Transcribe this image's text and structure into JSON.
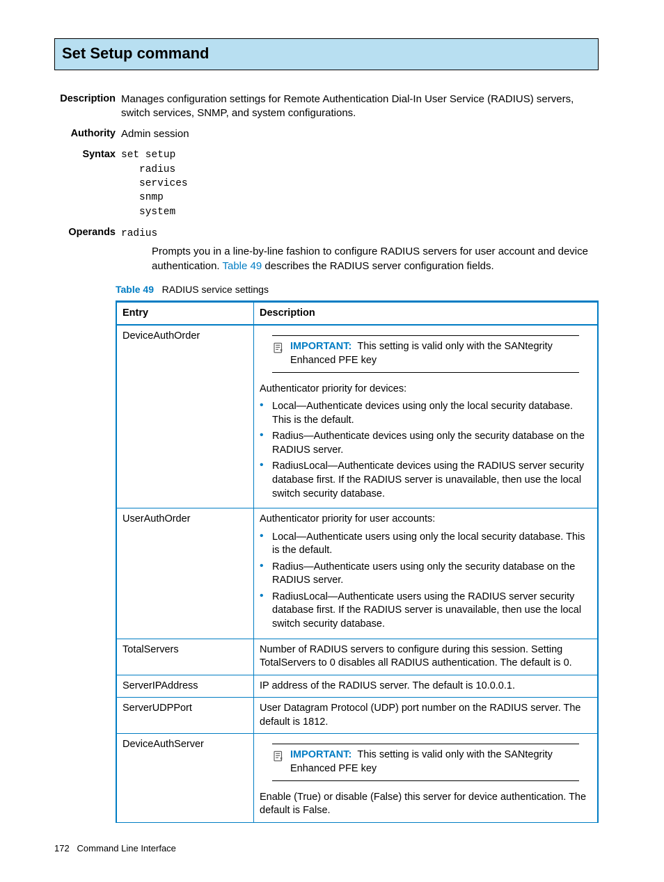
{
  "heading": "Set Setup command",
  "sections": {
    "description_label": "Description",
    "description_text": "Manages configuration settings for Remote Authentication Dial-In User Service (RADIUS) servers, switch services, SNMP, and system configurations.",
    "authority_label": "Authority",
    "authority_text": "Admin session",
    "syntax_label": "Syntax",
    "syntax_main": "set setup",
    "syntax_subs": [
      "radius",
      "services",
      "snmp",
      "system"
    ],
    "operands_label": "Operands",
    "operand_term": "radius",
    "operand_desc_1": "Prompts you in a line-by-line fashion to configure RADIUS servers for user account and device authentication. ",
    "operand_link": "Table 49",
    "operand_desc_2": " describes the RADIUS server configuration fields."
  },
  "table_caption_number": "Table 49",
  "table_caption_text": "RADIUS service settings",
  "table_headers": {
    "entry": "Entry",
    "description": "Description"
  },
  "important_label": "IMPORTANT:",
  "important_text": "This setting is valid only with the SANtegrity Enhanced PFE key",
  "rows": {
    "r1": {
      "entry": "DeviceAuthOrder",
      "para": "Authenticator priority for devices:",
      "b1": "Local—Authenticate devices using only the local security database. This is the default.",
      "b2": "Radius—Authenticate devices using only the security database on the RADIUS server.",
      "b3": "RadiusLocal—Authenticate devices using the RADIUS server security database first. If the RADIUS server is unavailable, then use the local switch security database."
    },
    "r2": {
      "entry": "UserAuthOrder",
      "para": "Authenticator priority for user accounts:",
      "b1": "Local—Authenticate users using only the local security database. This is the default.",
      "b2": "Radius—Authenticate users using only the security database on the RADIUS server.",
      "b3": "RadiusLocal—Authenticate users using the RADIUS server security database first. If the RADIUS server is unavailable, then use the local switch security database."
    },
    "r3": {
      "entry": "TotalServers",
      "desc": "Number of RADIUS servers to configure during this session. Setting TotalServers to 0 disables all RADIUS authentication. The default is 0."
    },
    "r4": {
      "entry": "ServerIPAddress",
      "desc": "IP address of the RADIUS server. The default is 10.0.0.1."
    },
    "r5": {
      "entry": "ServerUDPPort",
      "desc": "User Datagram Protocol (UDP) port number on the RADIUS server. The default is 1812."
    },
    "r6": {
      "entry": "DeviceAuthServer",
      "desc": "Enable (True) or disable (False) this server for device authentication. The default is False."
    }
  },
  "footer": {
    "page": "172",
    "title": "Command Line Interface"
  }
}
